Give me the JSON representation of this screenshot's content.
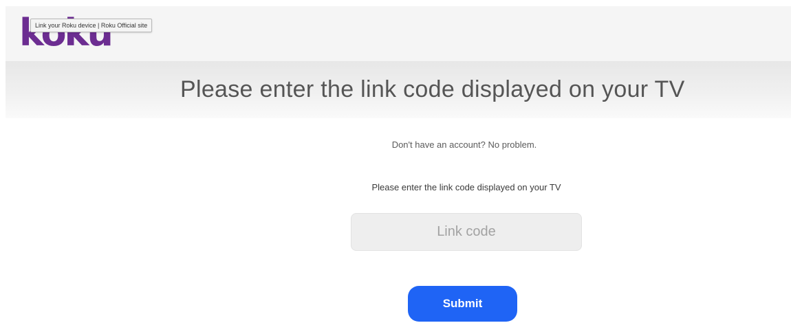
{
  "header": {
    "logo_text": "Roku",
    "tooltip": "Link your Roku device | Roku Official site"
  },
  "banner": {
    "title": "Please enter the link code displayed on your TV"
  },
  "main": {
    "account_note": "Don't have an account? No problem.",
    "prompt": "Please enter the link code displayed on your TV",
    "link_code": {
      "value": "",
      "placeholder": "Link code"
    },
    "submit_label": "Submit"
  },
  "colors": {
    "brand": "#6c2d91",
    "button": "#1f64f5"
  }
}
